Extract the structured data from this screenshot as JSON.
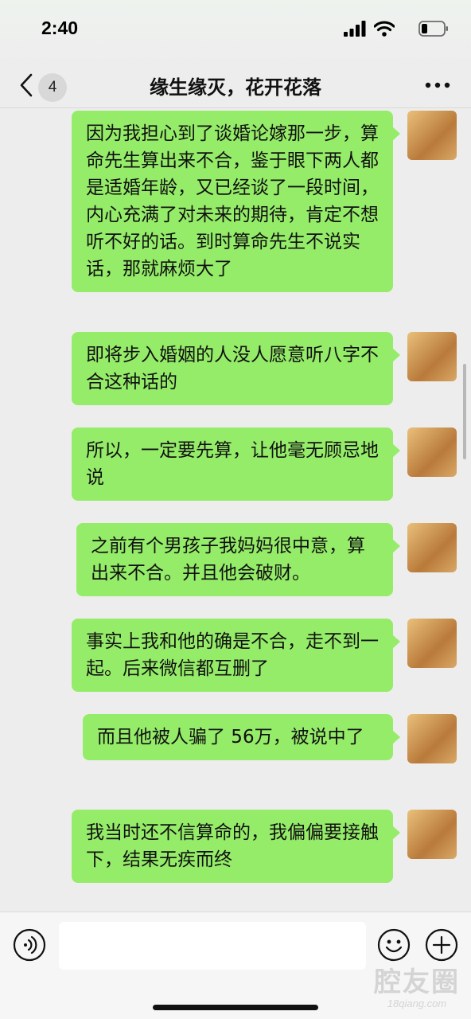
{
  "status_bar": {
    "time": "2:40"
  },
  "nav": {
    "unread_count": "4",
    "title": "缘生缘灭，花开花落"
  },
  "messages": [
    {
      "text": "因为我担心到了谈婚论嫁那一步，算命先生算出来不合，鉴于眼下两人都是适婚年龄，又已经谈了一段时间，内心充满了对未来的期待，肯定不想听不好的话。到时算命先生不说实话，那就麻烦大了"
    },
    {
      "text": "即将步入婚姻的人没人愿意听八字不合这种话的"
    },
    {
      "text": "所以，一定要先算，让他毫无顾忌地说"
    },
    {
      "text": "之前有个男孩子我妈妈很中意，算出来不合。并且他会破财。"
    },
    {
      "text": "事实上我和他的确是不合，走不到一起。后来微信都互删了"
    },
    {
      "text": "而且他被人骗了 56万，被说中了"
    },
    {
      "text": "我当时还不信算命的，我偏偏要接触下，结果无疾而终"
    }
  ],
  "input": {
    "placeholder": ""
  },
  "watermark": {
    "main": "腔友圈",
    "sub": "18qiang.com"
  },
  "colors": {
    "bubble": "#95ec69",
    "background": "#ededed"
  },
  "icons": [
    "signal-icon",
    "wifi-icon",
    "battery-icon",
    "chevron-left-icon",
    "more-icon",
    "voice-icon",
    "emoji-icon",
    "plus-icon"
  ]
}
